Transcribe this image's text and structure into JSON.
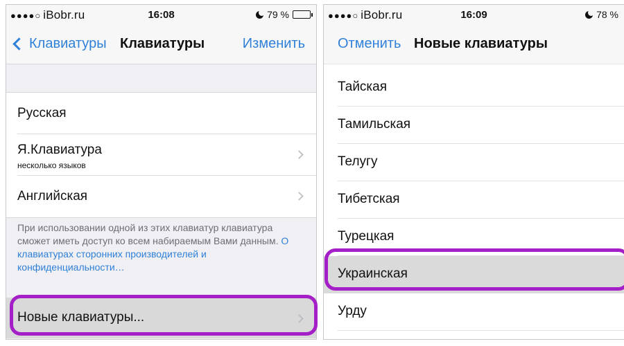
{
  "left_screen": {
    "status": {
      "carrier": "iBobr.ru",
      "time": "16:08",
      "battery": "79 %",
      "battery_level": 0.79
    },
    "nav": {
      "back_label": "Клавиатуры",
      "title": "Клавиатуры",
      "action_label": "Изменить"
    },
    "keyboards": [
      {
        "label": "Русская",
        "sublabel": ""
      },
      {
        "label": "Я.Клавиатура",
        "sublabel": "несколько языков"
      },
      {
        "label": "Английская",
        "sublabel": ""
      }
    ],
    "footnote": {
      "text": "При использовании одной из этих клавиатур клавиатура сможет иметь доступ ко всем набираемым Вами данным. ",
      "link": "О клавиатурах сторонних производителей и конфиденциальности…"
    },
    "new_keyboard_label": "Новые клавиатуры..."
  },
  "right_screen": {
    "status": {
      "carrier": "iBobr.ru",
      "time": "16:09",
      "battery": "78 %",
      "battery_level": 0.78
    },
    "nav": {
      "cancel_label": "Отменить",
      "title": "Новые клавиатуры"
    },
    "languages": [
      "Тайская",
      "Тамильская",
      "Телугу",
      "Тибетская",
      "Турецкая",
      "Украинская",
      "Урду"
    ],
    "selected_language": "Украинская"
  },
  "colors": {
    "accent": "#2f80d8",
    "highlight": "#a51fc8"
  }
}
